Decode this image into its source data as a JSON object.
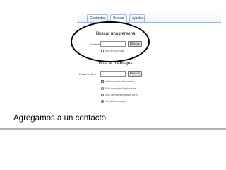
{
  "tabs": [
    {
      "label": "Contactos"
    },
    {
      "label": "Buscar"
    },
    {
      "label": "Ajustes"
    }
  ],
  "search_person": {
    "title": "Buscar una persona",
    "name_label": "Nombre",
    "name_value": "",
    "button_label": "Buscar",
    "only_my_lists_label": "Sólo en mis listas"
  },
  "search_messages": {
    "title": "Buscar mensajes",
    "keyword_label": "Palabra clave",
    "keyword_value": "",
    "button_label": "Buscar",
    "include_sent_label": "Incluir usuarios bloqueados",
    "options": [
      {
        "label": "Sólo mensajes dirigidos a mí",
        "selected": false
      },
      {
        "label": "Sólo mensajes enviados por mí",
        "selected": false
      },
      {
        "label": "Todos los mensajes",
        "selected": true
      }
    ]
  },
  "caption": "Agregamos a un contacto"
}
